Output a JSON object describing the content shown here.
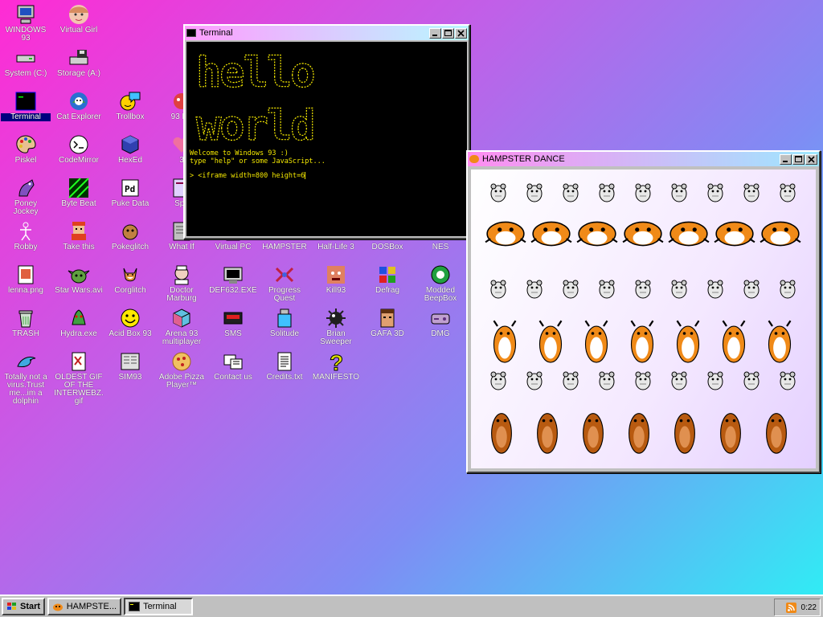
{
  "desktop": {
    "icons": [
      {
        "label": "WINDOWS 93",
        "icon": "computer-icon"
      },
      {
        "label": "Virtual Girl",
        "icon": "girl-icon"
      },
      {
        "label": "System (C:)",
        "icon": "drive-icon"
      },
      {
        "label": "Storage (A:)",
        "icon": "floppy-drive-icon"
      },
      {
        "label": "Terminal",
        "icon": "terminal-icon"
      },
      {
        "label": "Cat Explorer",
        "icon": "cat-explorer-icon"
      },
      {
        "label": "Trollbox",
        "icon": "trollbox-icon"
      },
      {
        "label": "93 Re",
        "icon": "robot-icon"
      },
      {
        "label": "Piskel",
        "icon": "palette-icon"
      },
      {
        "label": "CodeMirror",
        "icon": "codemirror-icon"
      },
      {
        "label": "HexEd",
        "icon": "cube-icon"
      },
      {
        "label": "3",
        "icon": "heart-icon"
      },
      {
        "label": "Poney Jockey",
        "icon": "pony-icon"
      },
      {
        "label": "Byte Beat",
        "icon": "bytebeat-icon"
      },
      {
        "label": "Puke Data",
        "icon": "pd-icon"
      },
      {
        "label": "Spe",
        "icon": "speech-icon"
      },
      {
        "label": "Robby",
        "icon": "robby-icon"
      },
      {
        "label": "Take this",
        "icon": "take-this-icon"
      },
      {
        "label": "Pokeglitch",
        "icon": "pokeglitch-icon"
      },
      {
        "label": "What If",
        "icon": "what-if-icon"
      },
      {
        "label": "Virtual PC",
        "icon": "virtual-pc-icon"
      },
      {
        "label": "HAMPSTER",
        "icon": "hampster-icon"
      },
      {
        "label": "Half-Life 3",
        "icon": "half-life-icon"
      },
      {
        "label": "DOSBox",
        "icon": "dosbox-icon"
      },
      {
        "label": "NES",
        "icon": "nes-icon"
      },
      {
        "label": "lenna.png",
        "icon": "image-file-icon"
      },
      {
        "label": "Star Wars.avi",
        "icon": "yoda-icon"
      },
      {
        "label": "Corglitch",
        "icon": "corgi-icon"
      },
      {
        "label": "Doctor Marburg",
        "icon": "doctor-icon"
      },
      {
        "label": "DEF632.EXE",
        "icon": "exe-icon"
      },
      {
        "label": "Progress Quest",
        "icon": "progress-quest-icon"
      },
      {
        "label": "Kill93",
        "icon": "kill-icon"
      },
      {
        "label": "Defrag",
        "icon": "defrag-icon"
      },
      {
        "label": "Modded BeepBox",
        "icon": "beepbox-icon"
      },
      {
        "label": "TRASH",
        "icon": "trash-icon"
      },
      {
        "label": "Hydra.exe",
        "icon": "hydra-icon"
      },
      {
        "label": "Acid Box 93",
        "icon": "smiley-icon"
      },
      {
        "label": "Arena 93 multiplayer",
        "icon": "arena-cube-icon"
      },
      {
        "label": "SMS",
        "icon": "sms-icon"
      },
      {
        "label": "Solitude",
        "icon": "solitude-icon"
      },
      {
        "label": "Brian Sweeper",
        "icon": "mine-icon"
      },
      {
        "label": "GAFA 3D",
        "icon": "gafa-face-icon"
      },
      {
        "label": "DMG",
        "icon": "gameboy-icon"
      },
      {
        "label": "Totally not a virus.Trust me...im a dolphin",
        "icon": "dolphin-icon"
      },
      {
        "label": "OLDEST GIF OF THE INTERWEBZ.gif",
        "icon": "gif-file-icon"
      },
      {
        "label": "SIM93",
        "icon": "sim-icon"
      },
      {
        "label": "Adobe Pizza Player™",
        "icon": "pizza-icon"
      },
      {
        "label": "Contact us",
        "icon": "contact-icon"
      },
      {
        "label": "Credits.txt",
        "icon": "text-file-icon"
      },
      {
        "label": "MANIFESTO",
        "icon": "question-icon"
      }
    ]
  },
  "terminal": {
    "title": "Terminal",
    "ascii_line1": "hello",
    "ascii_line2": "world",
    "welcome": "Welcome to Windows 93 :)",
    "hint": "type \"help\" or some JavaScript...",
    "prompt": ">",
    "command": "<iframe width=800 height=6"
  },
  "hampster": {
    "title": "HAMPSTER DANCE"
  },
  "taskbar": {
    "start": "Start",
    "items": [
      "HAMPSTE...",
      "Terminal"
    ],
    "clock": "0:22"
  },
  "colors": {
    "terminal_text": "#f4e800",
    "selection": "#00007f",
    "hamster_orange": "#f08a18",
    "hamster_brown": "#b85a10"
  }
}
